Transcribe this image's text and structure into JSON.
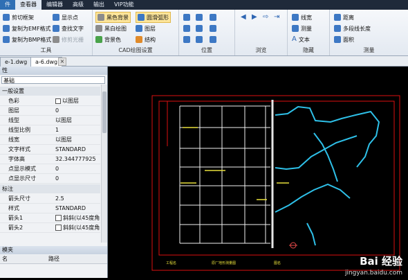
{
  "menubar": {
    "items": [
      "件",
      "查看器",
      "编辑器",
      "高级",
      "输出",
      "VIP功能"
    ]
  },
  "ribbon": {
    "tools": {
      "label": "工具",
      "buttons": [
        "剪切框架",
        "复制为EMF格式",
        "复制为BMP格式",
        "显示点",
        "查找文字",
        "修剪光栅"
      ]
    },
    "cad_settings": {
      "label": "CAD绘图设置",
      "buttons": [
        "黑色背景",
        "黑白绘图",
        "背景色",
        "圆滑弧形",
        "图层",
        "结构"
      ]
    },
    "position": {
      "label": "位置"
    },
    "browse": {
      "label": "浏览"
    },
    "hide": {
      "label": "隐藏",
      "buttons": [
        "线宽",
        "测量",
        "文本"
      ]
    },
    "measure": {
      "label": "测量",
      "buttons": [
        "距离",
        "多段线长度",
        "面积"
      ]
    }
  },
  "tabs": [
    "e-1.dwg",
    "a-6.dwg"
  ],
  "panel": {
    "title": "性",
    "combo_value": "基础",
    "section_general": "一般设置",
    "rows": [
      {
        "key": "色彩",
        "value": "以图层"
      },
      {
        "key": "图层",
        "value": "0"
      },
      {
        "key": "线型",
        "value": "以图层"
      },
      {
        "key": "线型比例",
        "value": "1"
      },
      {
        "key": "线宽",
        "value": "以图层"
      },
      {
        "key": "文字样式",
        "value": "STANDARD"
      },
      {
        "key": "字体高",
        "value": "32.344777925"
      },
      {
        "key": "点显示模式",
        "value": "0"
      },
      {
        "key": "点显示尺寸",
        "value": "0"
      }
    ],
    "section_annotation": "标注",
    "rows2": [
      {
        "key": "箭头尺寸",
        "value": "2.5"
      },
      {
        "key": "样式",
        "value": "STANDARD"
      },
      {
        "key": "箭头1",
        "value": "斜斜(以45度角"
      },
      {
        "key": "箭头2",
        "value": "斜斜(以45度角"
      }
    ],
    "bottom_title": "模夹",
    "col1": "名",
    "col2": "路径"
  },
  "drawing": {
    "bottom_labels": [
      "工程名",
      "原厂地形测量图",
      "图名"
    ]
  },
  "watermark": {
    "brand": "Bai 经验",
    "url": "jingyan.baidu.com"
  }
}
